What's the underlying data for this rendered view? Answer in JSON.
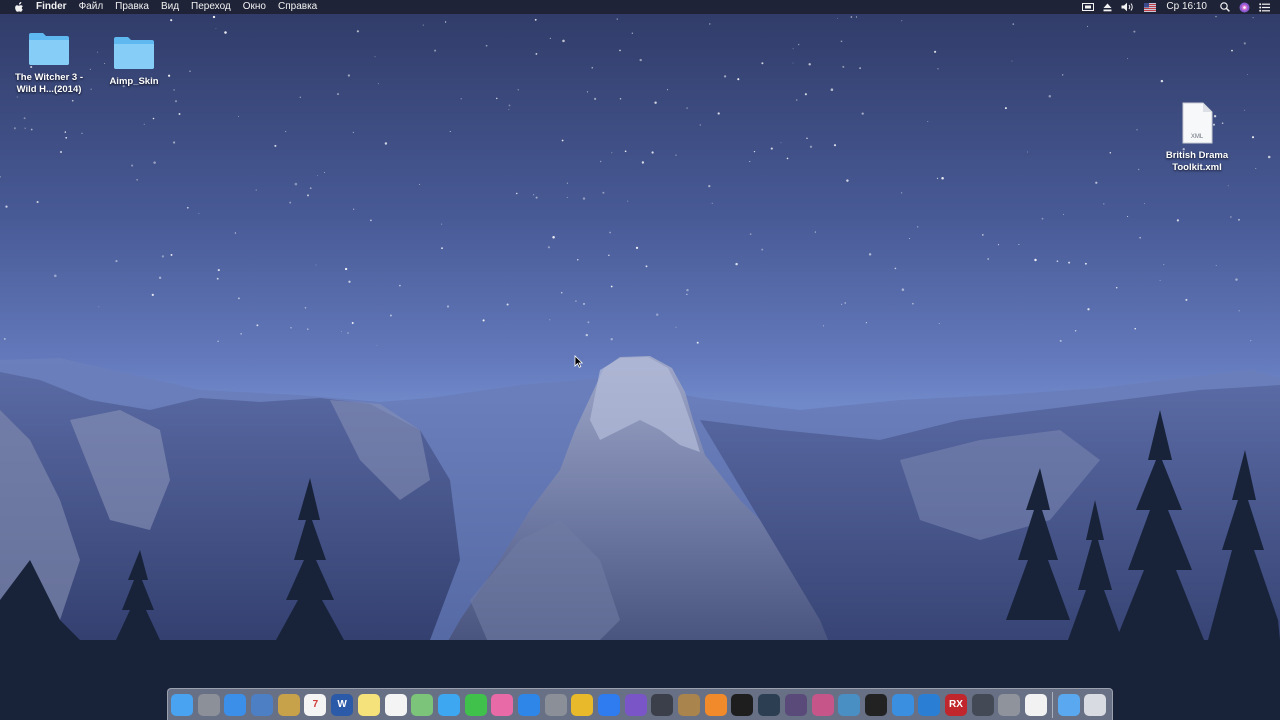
{
  "menubar": {
    "app_name": "Finder",
    "menus": [
      "Файл",
      "Правка",
      "Вид",
      "Переход",
      "Окно",
      "Справка"
    ],
    "clock": "Ср 16:10",
    "status_icons": [
      "screen-mirroring-icon",
      "eject-icon",
      "volume-icon",
      "keyboard-layout-flag-icon"
    ]
  },
  "desktop": {
    "icons": [
      {
        "name": "The Witcher 3 -\nWild H...(2014)",
        "kind": "folder"
      },
      {
        "name": "Aimp_Skin",
        "kind": "folder"
      },
      {
        "name": "British Drama\nToolkit.xml",
        "kind": "xml-document",
        "badge": "XML"
      }
    ]
  },
  "dock": {
    "apps": [
      {
        "name": "finder-icon",
        "color": "#4aa3f0"
      },
      {
        "name": "launchpad-icon",
        "color": "#8c9099"
      },
      {
        "name": "safari-icon",
        "color": "#3b8fe8"
      },
      {
        "name": "preview-icon",
        "color": "#4d7fc4"
      },
      {
        "name": "notes-folder-icon",
        "color": "#c8a24a"
      },
      {
        "name": "calendar-icon",
        "color": "#f4f4f4",
        "text": "7"
      },
      {
        "name": "word-icon",
        "color": "#2b5aa8",
        "text": "W"
      },
      {
        "name": "notes-icon",
        "color": "#f6e27a"
      },
      {
        "name": "textedit-icon",
        "color": "#f4f4f4"
      },
      {
        "name": "maps-icon",
        "color": "#7cc47a"
      },
      {
        "name": "messages-icon",
        "color": "#3da7f2"
      },
      {
        "name": "facetime-icon",
        "color": "#3fc14c"
      },
      {
        "name": "itunes-icon",
        "color": "#e86aa6"
      },
      {
        "name": "app-store-icon",
        "color": "#2e86e8"
      },
      {
        "name": "system-preferences-icon",
        "color": "#8a8f98"
      },
      {
        "name": "chrome-icon",
        "color": "#e8b92a"
      },
      {
        "name": "messenger-icon",
        "color": "#2f7cf0"
      },
      {
        "name": "viber-icon",
        "color": "#7a55c7"
      },
      {
        "name": "archive-utility-icon",
        "color": "#3b3f4a"
      },
      {
        "name": "unarchiver-icon",
        "color": "#a9844c"
      },
      {
        "name": "fl-studio-icon",
        "color": "#f08a2a"
      },
      {
        "name": "garageband-icon",
        "color": "#1e1e1e"
      },
      {
        "name": "audio-hijack-icon",
        "color": "#2c3f52"
      },
      {
        "name": "final-cut-icon",
        "color": "#5a4a7a"
      },
      {
        "name": "motion-icon",
        "color": "#c6558a"
      },
      {
        "name": "compressor-icon",
        "color": "#4a8fc4"
      },
      {
        "name": "piano-keys-icon",
        "color": "#222222"
      },
      {
        "name": "files-icon",
        "color": "#3a8fe0"
      },
      {
        "name": "audio-analyzer-icon",
        "color": "#2a7fd4"
      },
      {
        "name": "rx-audio-icon",
        "color": "#c0262b",
        "text": "RX"
      },
      {
        "name": "disk-utility-icon",
        "color": "#444a55"
      },
      {
        "name": "microphone-icon",
        "color": "#8f949c"
      },
      {
        "name": "document-icon",
        "color": "#f2f2f2"
      },
      {
        "name": "downloads-folder-icon",
        "color": "#5aa9f0"
      },
      {
        "name": "trash-icon",
        "color": "#d8dbe2"
      }
    ]
  }
}
